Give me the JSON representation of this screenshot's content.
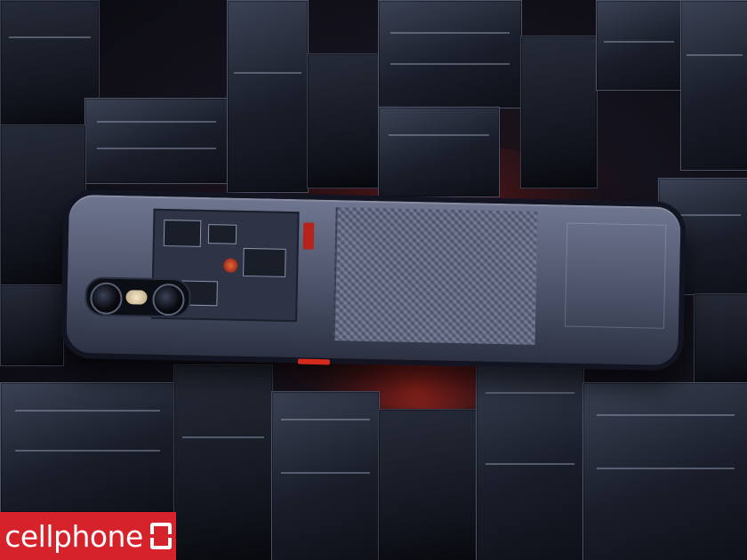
{
  "brand": {
    "name": "cellphone",
    "mark_icon": "s-square-icon",
    "color": "#d6222a"
  },
  "scene": {
    "accent_glow": "#d22d1e",
    "block_color": "#2a2f3e"
  }
}
